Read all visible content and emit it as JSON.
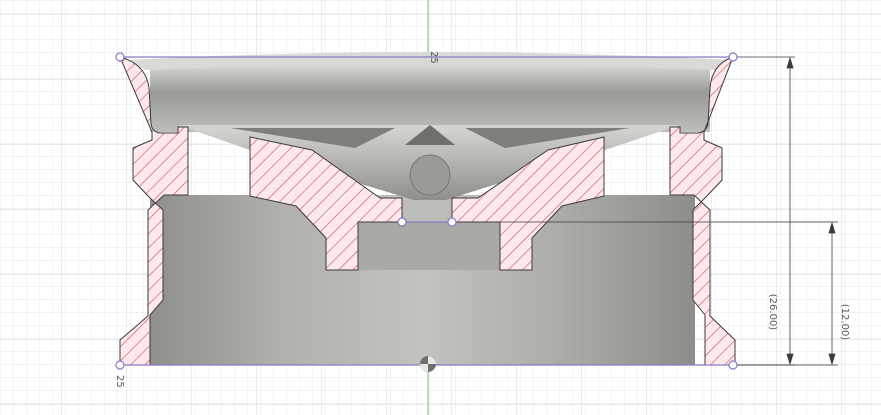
{
  "viewport": {
    "background": "#ffffff",
    "grid_color_minor": "#e7e9ec",
    "grid_color_major": "#d3d6db",
    "axis_color": "#6bc36b"
  },
  "part": {
    "body_color": "#a7a7a3",
    "rim_color": "#c7c7c3",
    "section_hatch_bg": "#fde9ec",
    "section_hatch_line": "#c05060",
    "section_outline": "#3b3b3b",
    "selection_color": "#8c78c8"
  },
  "labels": {
    "top_center": "25",
    "bottom_left": "25",
    "dim_total": "(26.00)",
    "dim_lower": "(12.00)"
  },
  "icons": {
    "origin_marker": "origin-point-icon"
  }
}
